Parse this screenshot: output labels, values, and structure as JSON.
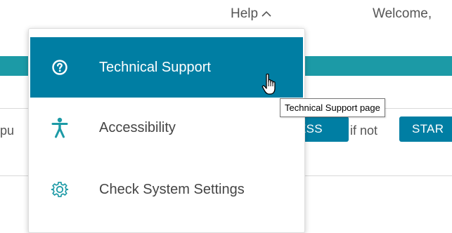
{
  "header": {
    "help_label": "Help",
    "help_icon": "chevron-up-icon",
    "welcome_text": "Welcome,"
  },
  "background": {
    "row_text_left": "pu",
    "button_1_label": "ESS",
    "row_text_middle": "if not",
    "button_2_label": "STAR",
    "accent_color": "#1c9aa6",
    "button_color": "#007ea3"
  },
  "help_menu": {
    "items": [
      {
        "label": "Technical Support",
        "icon": "question-circle-icon",
        "state": "hovered"
      },
      {
        "label": "Accessibility",
        "icon": "accessibility-person-icon",
        "state": "normal"
      },
      {
        "label": "Check System Settings",
        "icon": "gear-icon",
        "state": "normal"
      }
    ],
    "hover_color": "#007ea3",
    "icon_color": "#1c9aa6"
  },
  "tooltip": {
    "text": "Technical Support page"
  }
}
